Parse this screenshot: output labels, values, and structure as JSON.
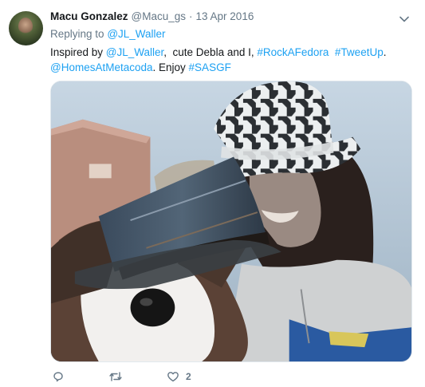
{
  "tweet": {
    "author_name": "Macu Gonzalez",
    "author_handle": "@Macu_gs",
    "separator": "·",
    "date": "13 Apr 2016",
    "replying_prefix": "Replying to",
    "replying_to": "@JL_Waller",
    "text": {
      "part1": "Inspired by ",
      "mention1": "@JL_Waller",
      "part2": ",  cute Debla and I, ",
      "hashtag1": "#RockAFedora",
      "part3": "  ",
      "hashtag2": "#TweetUp",
      "part4": ".",
      "mention2": "@HomesAtMetacoda",
      "part5": ". Enjoy ",
      "hashtag3": "#SASGF"
    },
    "media_description_icon": "photo",
    "actions": {
      "reply_icon": "reply-icon",
      "retweet_icon": "retweet-icon",
      "like_icon": "heart-icon",
      "like_count": "2"
    }
  },
  "colors": {
    "link": "#1da1f2",
    "secondary_text": "#657786",
    "primary_text": "#14171a"
  }
}
